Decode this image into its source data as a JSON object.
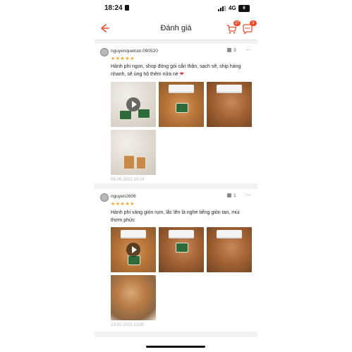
{
  "status_bar": {
    "time": "18:24",
    "network": "4G",
    "battery": "6"
  },
  "header": {
    "title": "Đánh giá",
    "cart_count": "27",
    "chat_count": "5"
  },
  "reviews": [
    {
      "username": "nguyenquetran.090520",
      "likes": "3",
      "stars": "★★★★★",
      "text": "Hành phi ngon, shop đóng gói cẩn thận, sạch sẽ, ship hàng nhanh, sẽ ủng hộ thêm nữa nè",
      "date": "05-09-2022 10:24"
    },
    {
      "username": "nguyen2606",
      "likes": "1",
      "stars": "★★★★★",
      "text": "Hành phi vàng giòn rụm, lắc lên là nghe tiếng giòn tan, mùi thơm phức",
      "date": "23-02-2022 13:50"
    }
  ],
  "more_label": "···",
  "colors": {
    "accent": "#ee4d2d",
    "star": "#f5a623"
  }
}
